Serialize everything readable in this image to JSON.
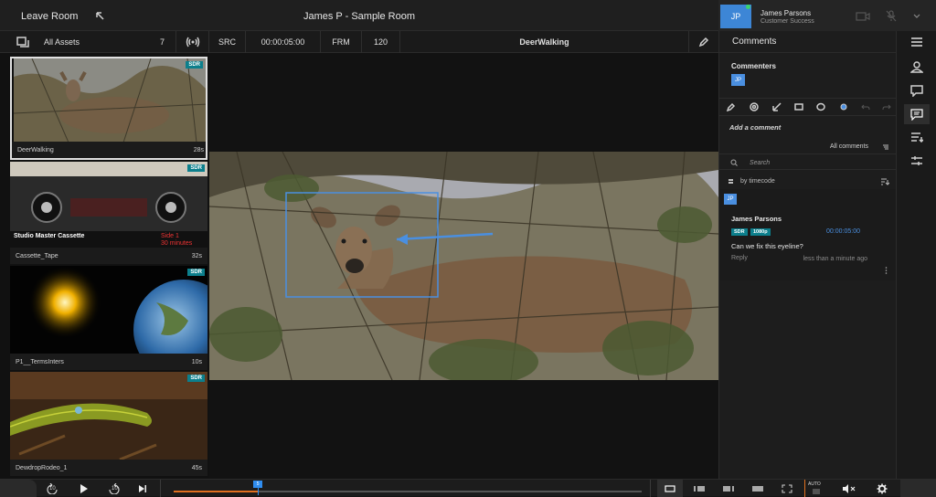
{
  "topbar": {
    "leave_label": "Leave Room",
    "room_title": "James P - Sample Room",
    "user_initials": "JP",
    "user_name": "James Parsons",
    "user_role": "Customer Success"
  },
  "toolbar": {
    "assets_label": "All Assets",
    "asset_count": "7",
    "src_label": "SRC",
    "timecode": "00:00:05:00",
    "frm_label": "FRM",
    "frame_number": "120",
    "clip_title": "DeerWalking"
  },
  "assets": [
    {
      "name": "DeerWalking",
      "duration": "28s",
      "badge": "SDR"
    },
    {
      "name": "Cassette_Tape",
      "duration": "32s",
      "badge": "SDR",
      "overlay_left": "Studio Master Cassette",
      "overlay_right_1": "Side 1",
      "overlay_right_2": "30 minutes"
    },
    {
      "name": "P1__TermsInters",
      "duration": "10s",
      "badge": "SDR"
    },
    {
      "name": "DewdropRodeo_1",
      "duration": "45s",
      "badge": "SDR"
    }
  ],
  "comments_panel": {
    "header": "Comments",
    "commenters_label": "Commenters",
    "commenter_initials": "JP",
    "add_comment_placeholder": "Add a comment",
    "filter_label": "All comments",
    "search_placeholder": "Search",
    "sort_label": "by timecode",
    "comment": {
      "initials": "JP",
      "author": "James Parsons",
      "badge_sdr": "SDR",
      "badge_res": "1080p",
      "timecode": "00:00:05:00",
      "text": "Can we fix this eyeline?",
      "reply_label": "Reply",
      "time_ago": "less than a minute ago"
    }
  },
  "transport": {
    "auto_label": "AUTO",
    "rewind_label": "10",
    "forward_label": "10",
    "playhead_label": "5",
    "progress_fraction": 0.18
  },
  "colors": {
    "accent_blue": "#4a8fe0",
    "sdr_teal": "#0c7f8c",
    "playhead_blue": "#2f8df0",
    "progress_orange": "#e07020"
  }
}
